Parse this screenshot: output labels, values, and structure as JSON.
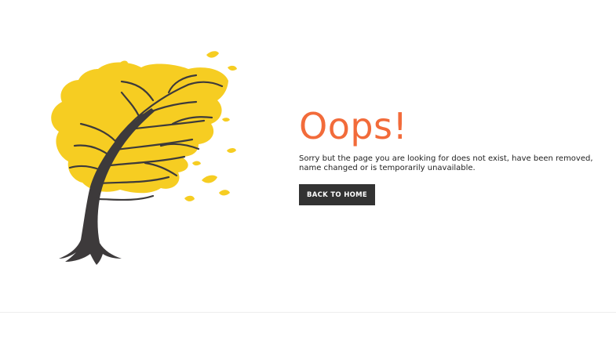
{
  "hero": {
    "title": "Oops!",
    "message": "Sorry but the page you are looking for does not exist, have been removed, name changed or is temporarily unavailable.",
    "button_label": "BACK TO HOME"
  },
  "illustration": {
    "icon": "windblown-tree-icon"
  },
  "colors": {
    "title": "#f26b3a",
    "button": "#333333",
    "foliage": "#f6cd22",
    "trunk": "#3d3a3b"
  }
}
